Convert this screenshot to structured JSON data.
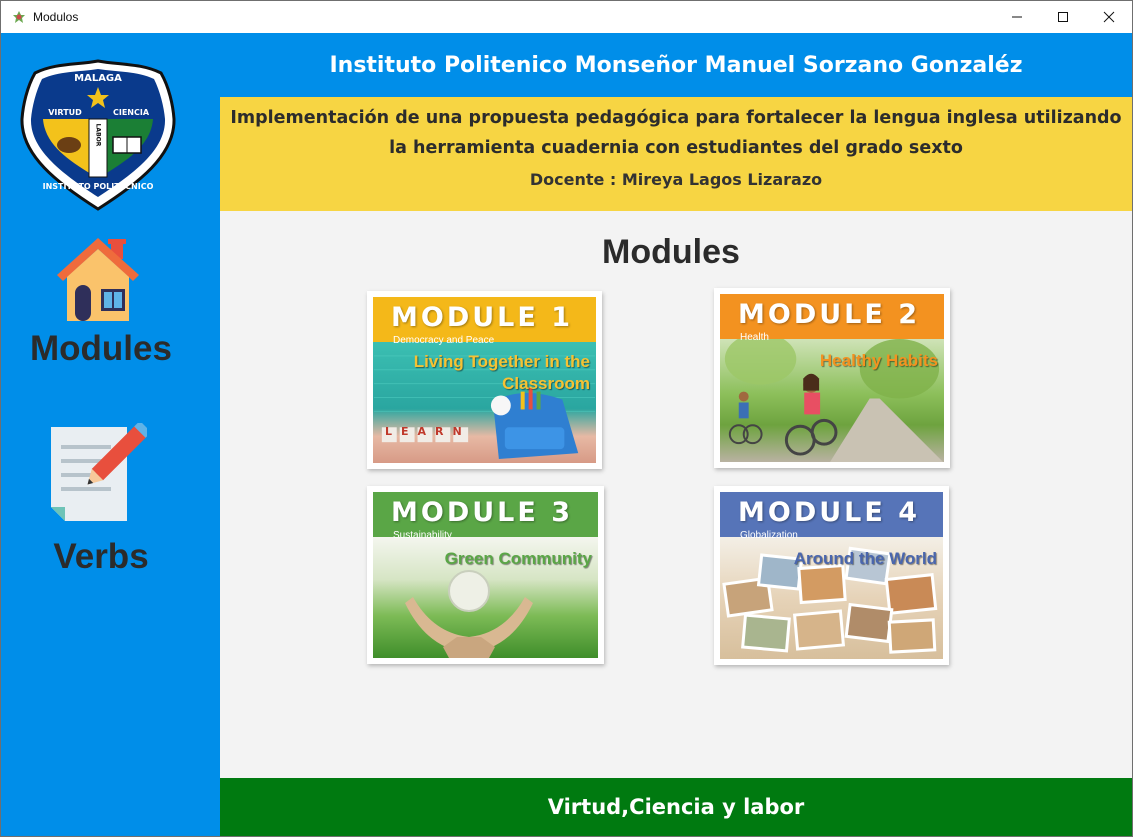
{
  "window": {
    "title": "Modulos",
    "controls": {
      "minimize": "minimize-icon",
      "maximize": "maximize-icon",
      "close": "close-icon"
    }
  },
  "logo": {
    "top_text": "MALAGA",
    "left_text": "VIRTUD",
    "right_text": "CIENCIA",
    "center_text": "LABOR",
    "bottom_text": "INSTITUTO POLITECNICO"
  },
  "sidebar": {
    "items": [
      {
        "label": "Modules",
        "icon": "home-icon"
      },
      {
        "label": "Verbs",
        "icon": "notepad-pencil-icon"
      }
    ]
  },
  "header": {
    "institution": "Instituto Politenico Monseñor Manuel Sorzano Gonzaléz",
    "project_line1": "Implementación de una propuesta pedagógica para  fortalecer la lengua inglesa utilizando",
    "project_line2": "la herramienta cuadernia con estudiantes del grado sexto",
    "teacher": "Docente : Mireya Lagos Lizarazo"
  },
  "main": {
    "heading": "Modules",
    "modules": [
      {
        "title": "MODULE 1",
        "subtheme": "Democracy and Peace",
        "topic_line1": "Living Together in the",
        "topic_line2": "Classroom",
        "banner_color": "#f4b819",
        "photo_text": "LEARN"
      },
      {
        "title": "MODULE 2",
        "subtheme": "Health",
        "topic_line1": "Healthy Habits",
        "topic_line2": "",
        "banner_color": "#f39220"
      },
      {
        "title": "MODULE 3",
        "subtheme": "Sustainability",
        "topic_line1": "Green Community",
        "topic_line2": "",
        "banner_color": "#5aa646"
      },
      {
        "title": "MODULE 4",
        "subtheme": "Globalization",
        "topic_line1": "Around the World",
        "topic_line2": "",
        "banner_color": "#5674b8"
      }
    ]
  },
  "footer": {
    "motto": "Virtud,Ciencia y labor"
  },
  "colors": {
    "sidebar": "#008ee9",
    "header_yellow": "#f7d543",
    "footer_green": "#007a10",
    "content_bg": "#f3f3f3"
  }
}
